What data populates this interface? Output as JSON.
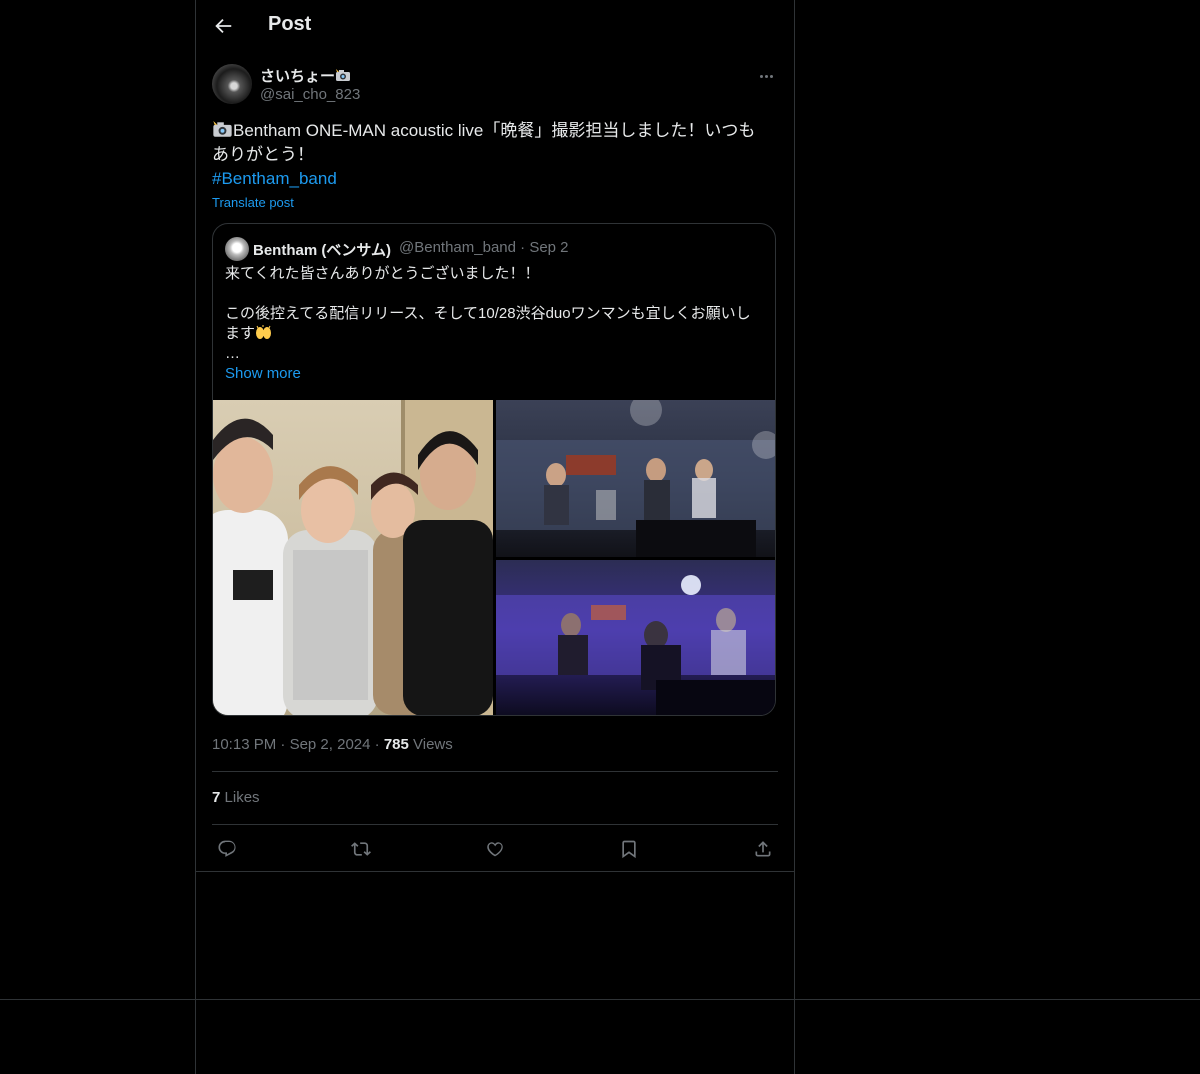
{
  "header": {
    "title": "Post"
  },
  "author": {
    "name": "さいちょー",
    "handle": "@sai_cho_823"
  },
  "tweet": {
    "text": "Bentham ONE-MAN acoustic live「晩餐」撮影担当しました！いつもありがとう！",
    "hashtag": "#Bentham_band",
    "translate_label": "Translate post"
  },
  "quote": {
    "name": "Bentham (ベンサム)",
    "handle": "@Bentham_band",
    "separator": "·",
    "date": "Sep 2",
    "line1": "来てくれた皆さんありがとうございました！！",
    "line2": "この後控えてる配信リリース、そして10/28渋谷duoワンマンも宜しくお願いします",
    "ellipsis": "…",
    "show_more": "Show more"
  },
  "meta": {
    "time": "10:13 PM",
    "date": "Sep 2, 2024",
    "dot": "·",
    "views_count": "785",
    "views_label": "Views"
  },
  "likes": {
    "count": "7",
    "label": "Likes"
  },
  "icons": {
    "back": "arrow-left-icon",
    "more": "more-icon",
    "reply": "reply-icon",
    "repost": "repost-icon",
    "like": "heart-icon",
    "bookmark": "bookmark-icon",
    "share": "share-icon"
  },
  "colors": {
    "background": "#000000",
    "text": "#e7e9ea",
    "muted": "#71767b",
    "link": "#1d9bf0",
    "border": "#2f3336"
  }
}
